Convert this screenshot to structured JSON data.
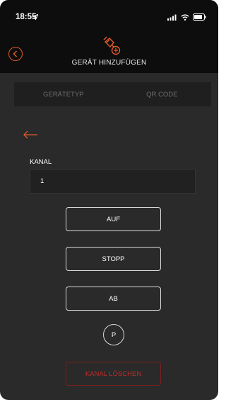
{
  "status_bar": {
    "time": "18:55"
  },
  "header": {
    "title": "GERÄT HINZUFÜGEN",
    "icon": "plug-add-icon"
  },
  "tabs": [
    {
      "label": "GERÄTETYP"
    },
    {
      "label": "QR CODE"
    }
  ],
  "channel": {
    "label": "KANAL",
    "value": "1"
  },
  "controls": {
    "up": "AUF",
    "stop": "STOPP",
    "down": "AB",
    "program": "P"
  },
  "delete_channel": "KANAL LÖSCHEN",
  "colors": {
    "accent": "#e05a2b",
    "danger": "#c02a2a",
    "background": "#2a2a2a"
  }
}
